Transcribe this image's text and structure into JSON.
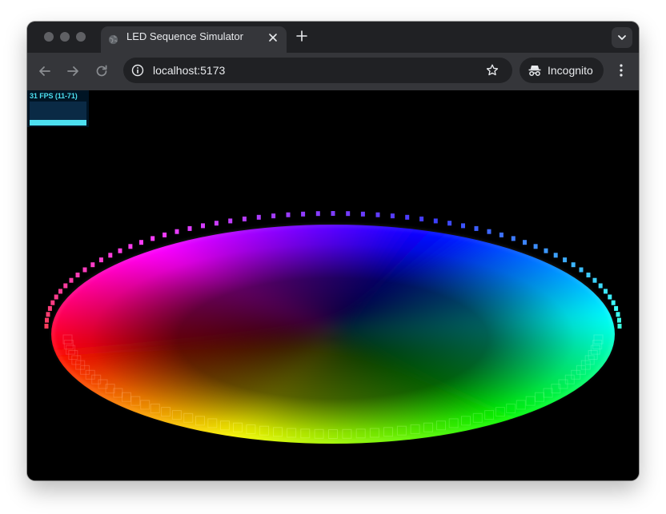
{
  "browser": {
    "tab": {
      "title": "LED Sequence Simulator",
      "favicon": "globe-icon"
    },
    "address_bar": {
      "url": "localhost:5173"
    },
    "profile": {
      "label": "Incognito",
      "icon": "incognito-icon"
    },
    "colors": {
      "tabbar": "#202124",
      "toolbar": "#35363a",
      "text": "#e8eaed"
    }
  },
  "simulator": {
    "fps_meter": {
      "text": "31 FPS (11-71)",
      "fps": 31,
      "min": 11,
      "max": 71,
      "color": "#4ddff0"
    },
    "led_ring": {
      "background": "#000000",
      "spectrum": "rainbow"
    }
  }
}
